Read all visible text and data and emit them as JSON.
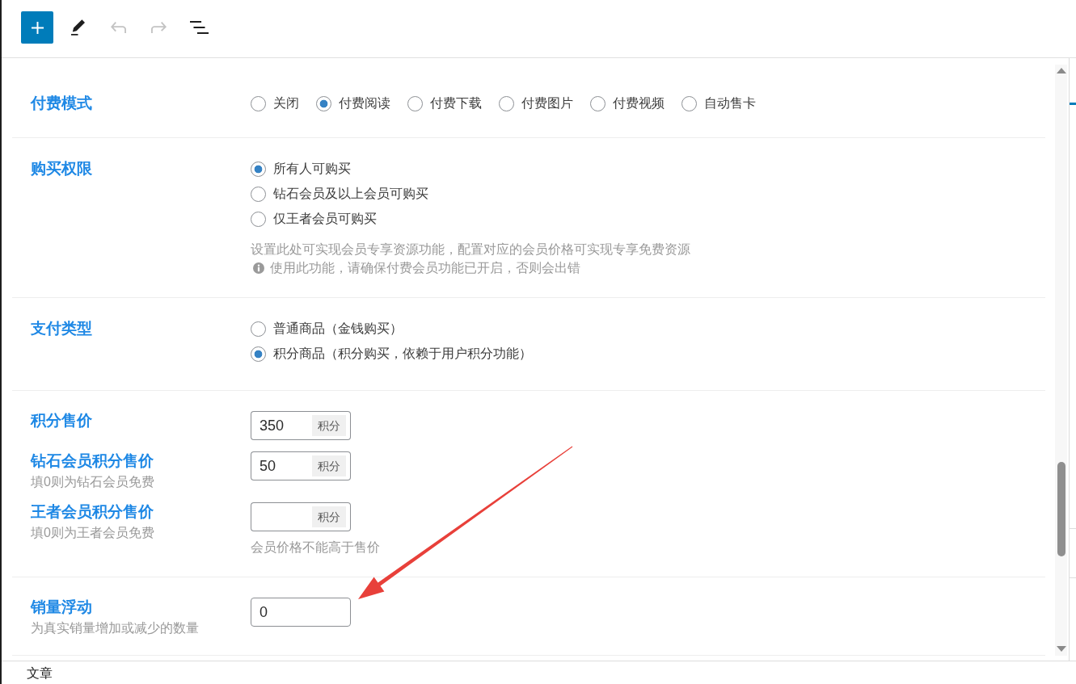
{
  "toolbar": [
    {
      "kind": "add",
      "disabled": false
    },
    {
      "kind": "edit",
      "disabled": false
    },
    {
      "kind": "undo",
      "disabled": true
    },
    {
      "kind": "redo",
      "disabled": true
    },
    {
      "kind": "outline",
      "disabled": false
    }
  ],
  "sections": [
    {
      "kind": "radio-inline",
      "label": "付费模式",
      "options": [
        {
          "label": "关闭",
          "selected": false
        },
        {
          "label": "付费阅读",
          "selected": true
        },
        {
          "label": "付费下载",
          "selected": false
        },
        {
          "label": "付费图片",
          "selected": false
        },
        {
          "label": "付费视频",
          "selected": false
        },
        {
          "label": "自动售卡",
          "selected": false
        }
      ]
    },
    {
      "kind": "radio-list",
      "label": "购买权限",
      "options": [
        {
          "label": "所有人可购买",
          "selected": true
        },
        {
          "label": "钻石会员及以上会员可购买",
          "selected": false
        },
        {
          "label": "仅王者会员可购买",
          "selected": false
        }
      ],
      "notes": [
        {
          "kind": "plain",
          "text": "设置此处可实现会员专享资源功能，配置对应的会员价格可实现专享免费资源"
        },
        {
          "kind": "info",
          "text": "使用此功能，请确保付费会员功能已开启，否则会出错"
        }
      ]
    },
    {
      "kind": "radio-list",
      "label": "支付类型",
      "options": [
        {
          "label": "普通商品（金钱购买）",
          "selected": false
        },
        {
          "label": "积分商品（积分购买，依赖于用户积分功能）",
          "selected": true
        }
      ]
    },
    {
      "kind": "fields",
      "fields": [
        {
          "label": "积分售价",
          "value": "350",
          "unit": "积分"
        },
        {
          "label": "钻石会员积分售价",
          "hint": "填0则为钻石会员免费",
          "value": "50",
          "unit": "积分"
        },
        {
          "label": "王者会员积分售价",
          "hint": "填0则为王者会员免费",
          "unit": "积分",
          "note": "会员价格不能高于售价"
        }
      ]
    },
    {
      "kind": "fields",
      "fields": [
        {
          "label": "销量浮动",
          "hint": "为真实销量增加或减少的数量",
          "value": "0"
        }
      ]
    }
  ],
  "footer": {
    "breadcrumb": "文章"
  }
}
